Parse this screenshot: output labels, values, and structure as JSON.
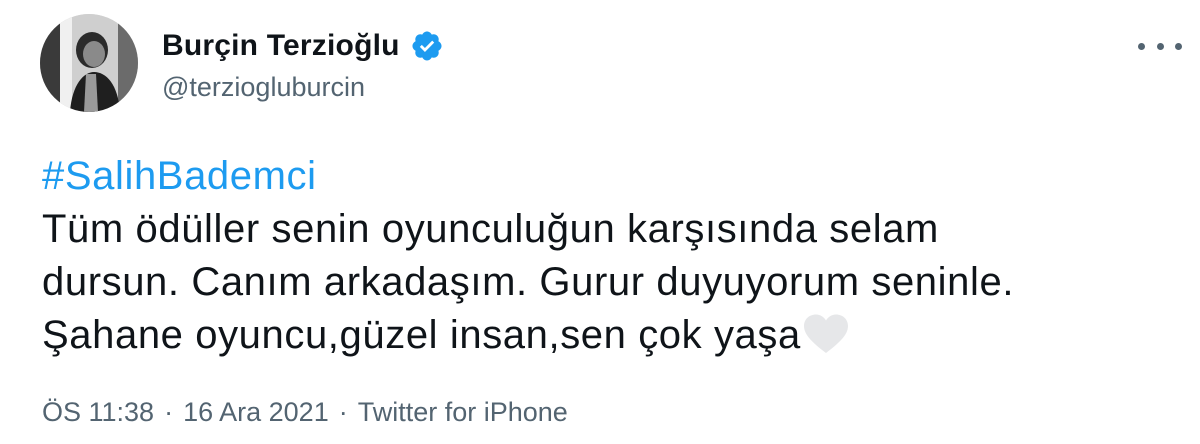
{
  "author": {
    "display_name": "Burçin Terzioğlu",
    "handle": "@terziogluburcin",
    "verified": true,
    "verified_color": "#1d9bf0"
  },
  "icons": {
    "verified": "verified-badge-icon",
    "more": "more-options-icon",
    "emoji": "white-heart-icon"
  },
  "tweet": {
    "hashtag": "#SalihBademci",
    "lines": [
      "Tüm ödüller senin oyunculuğun karşısında selam",
      "dursun. Canım arkadaşım. Gurur duyuyorum seninle.",
      "Şahane oyuncu,güzel insan,sen çok yaşa"
    ]
  },
  "meta": {
    "time": "ÖS 11:38",
    "separator": "·",
    "date": "16 Ara 2021",
    "source": "Twitter for iPhone"
  },
  "colors": {
    "text": "#0f1419",
    "secondary": "#536471",
    "link": "#1d9bf0",
    "heart": "#e6e7e9"
  }
}
